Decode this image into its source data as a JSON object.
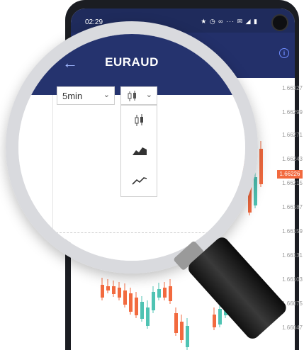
{
  "status_bar": {
    "time": "02:29",
    "indicators": "★ ◷ ∞ ··· ✉ ◢ ▮"
  },
  "app_bar": {
    "title": "EURAUD",
    "back_icon": "arrow-left-icon",
    "info_icon": "info-icon"
  },
  "toolbar": {
    "timeframe": {
      "value": "5min"
    },
    "chart_type": {
      "selected_icon": "candlestick-icon"
    }
  },
  "chart_type_menu": {
    "items": [
      {
        "icon": "candlestick-icon"
      },
      {
        "icon": "area-chart-icon"
      },
      {
        "icon": "line-chart-icon"
      }
    ]
  },
  "price_axis": {
    "labels": [
      "1.66327",
      "1.66299",
      "1.66271",
      "1.66243",
      "1.66215",
      "1.66187",
      "1.66159",
      "1.66131",
      "1.66103",
      "1.66075",
      "1.66047"
    ],
    "current_price": "1.66226"
  },
  "colors": {
    "bull": "#4fc3b3",
    "bear": "#f26a3f",
    "header": "#23306a"
  }
}
